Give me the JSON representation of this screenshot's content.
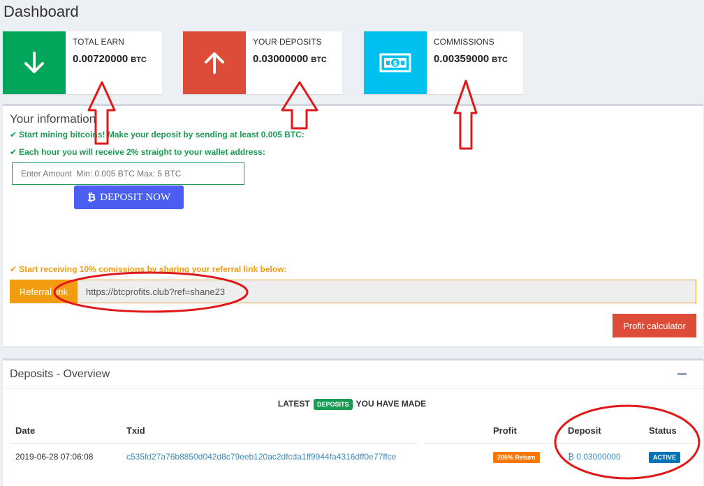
{
  "page": {
    "title": "Dashboard"
  },
  "stats": [
    {
      "label": "TOTAL EARN",
      "value": "0.00720000",
      "unit": "BTC",
      "icon": "arrow-down-icon",
      "color": "#00a65a"
    },
    {
      "label": "YOUR DEPOSITS",
      "value": "0.03000000",
      "unit": "BTC",
      "icon": "arrow-up-icon",
      "color": "#dd4b39"
    },
    {
      "label": "COMMISSIONS",
      "value": "0.00359000",
      "unit": "BTC",
      "icon": "money-icon",
      "color": "#00c0ef"
    }
  ],
  "info": {
    "title": "Your information",
    "line1": "Start mining bitcoins! Make your deposit by sending at least 0.005 BTC:",
    "line2": "Each hour you will receive 2% straight to your wallet address:",
    "amount_placeholder": "Enter Amount  Min: 0.005 BTC Max: 5 BTC",
    "deposit_button": "DEPOSIT NOW",
    "referral_line": "Start receiving 10% comissions by sharing your referral link below:",
    "referral_label": "Referral link",
    "referral_url": "https://btcprofits.club?ref=shane23",
    "calc_button": "Profit calculator"
  },
  "overview": {
    "title": "Deposits - Overview",
    "latest_prefix": "LATEST",
    "latest_badge": "DEPOSITS",
    "latest_suffix": "YOU HAVE MADE",
    "columns": [
      "Date",
      "Txid",
      "Profit",
      "Deposit",
      "Status"
    ],
    "rows": [
      {
        "date": "2019-06-28 07:06:08",
        "txid": "c535fd27a76b8850d042d8c79eeb120ac2dfcda1ff9944fa4316dff0e77ffce",
        "profit": "200% Return",
        "deposit": "0.03000000",
        "status": "ACTIVE"
      }
    ]
  },
  "colors": {
    "annotation_red": "#e01818"
  }
}
